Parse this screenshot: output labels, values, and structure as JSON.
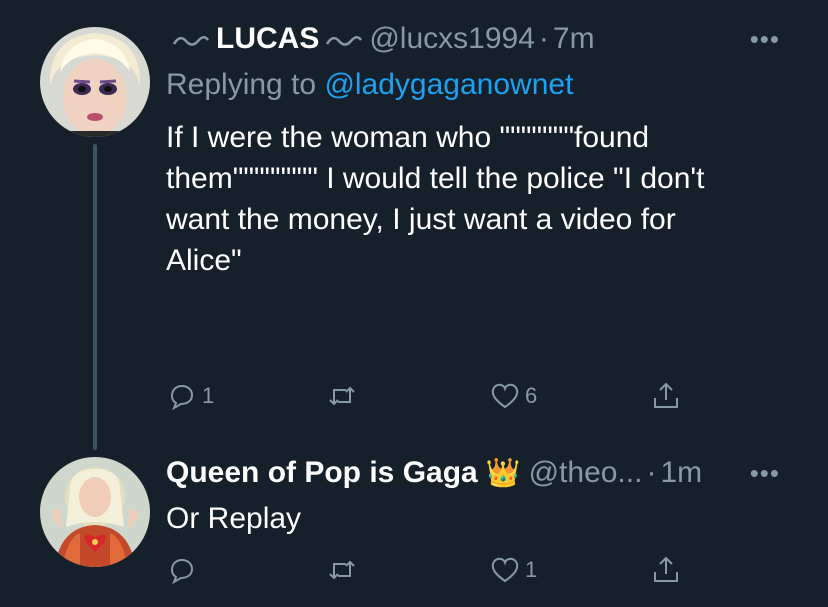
{
  "tweet1": {
    "name": "LUCAS",
    "handle": "@lucxs1994",
    "separator": "·",
    "time": "7m",
    "more_label": "•••",
    "replying_prefix": "Replying to",
    "replying_to": "@ladygaganownet",
    "text_lines": [
      "If I were the woman who \"\"\"\"\"\"\"found",
      "them\"\"\"\"\"\"\"\" I would tell the police \"I don't",
      "want the money, I just want a video for",
      "Alice\""
    ],
    "reply_count": "1",
    "retweet_count": "",
    "like_count": "6"
  },
  "tweet2": {
    "name": "Queen of Pop is Gaga",
    "badge_emoji": "👑",
    "handle": "@theo...",
    "separator": "·",
    "time": "1m",
    "more_label": "•••",
    "text": "Or Replay",
    "reply_count": "",
    "retweet_count": "",
    "like_count": "1"
  },
  "icons": {
    "reply": "reply-icon",
    "retweet": "retweet-icon",
    "like": "heart-icon",
    "share": "share-icon",
    "more": "more-icon"
  },
  "colors": {
    "background": "#15202b",
    "secondary_text": "#8899a6",
    "link": "#1da1f2",
    "thread_line": "#3d5466"
  }
}
